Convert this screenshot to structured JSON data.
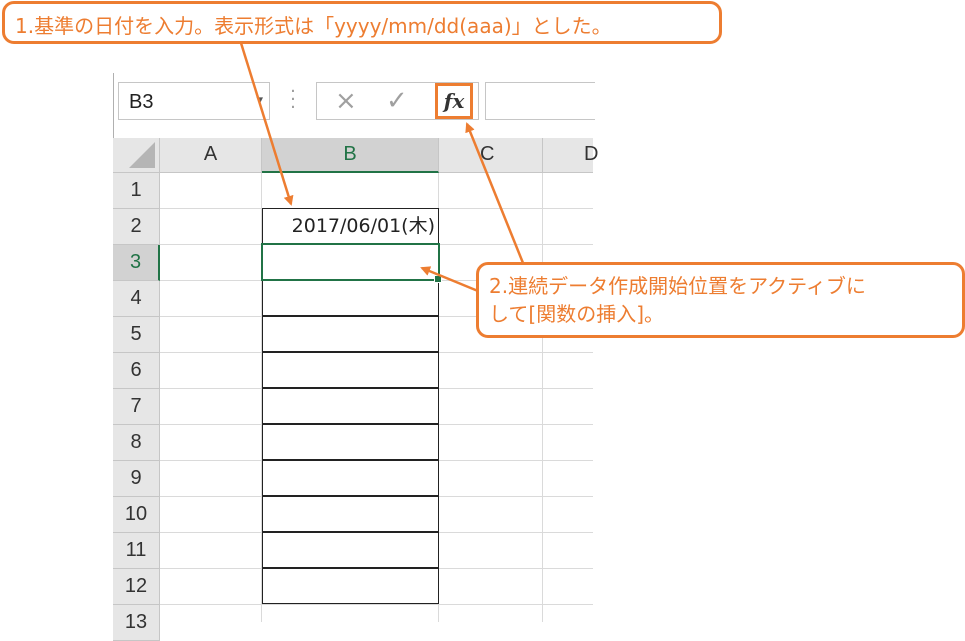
{
  "formula_bar": {
    "name_box": "B3",
    "cancel_icon": "×",
    "enter_icon": "✓",
    "fx_label": "fx"
  },
  "columns": [
    "A",
    "B",
    "C",
    "D"
  ],
  "rows": [
    "1",
    "2",
    "3",
    "4",
    "5",
    "6",
    "7",
    "8",
    "9",
    "10",
    "11",
    "12",
    "13"
  ],
  "active_cell": "B3",
  "cells": {
    "B2": "2017/06/01(木)"
  },
  "callouts": {
    "step1": "1.基準の日付を入力。表示形式は「yyyy/mm/dd(aaa)」とした。",
    "step2_line1": "2.連続データ作成開始位置をアクティブに",
    "step2_line2": "して[関数の挿入]。"
  },
  "colors": {
    "accent": "#ed7d31",
    "excel_green": "#217346"
  }
}
